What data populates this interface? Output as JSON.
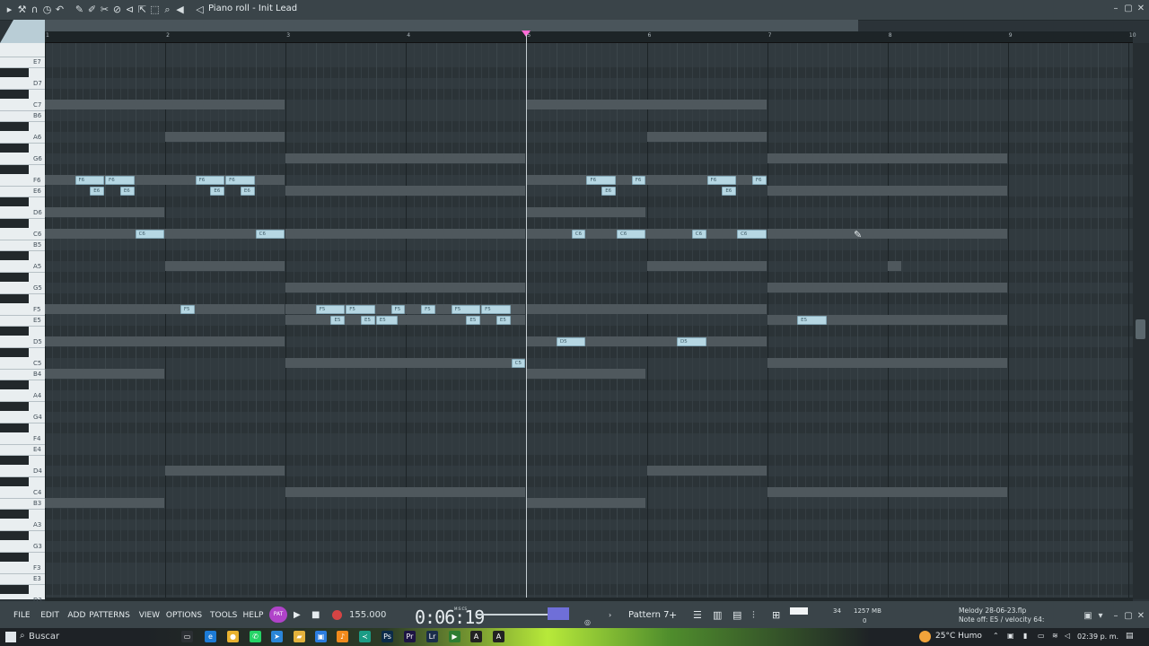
{
  "toolbar": {
    "title": "Piano roll - Init Lead",
    "icons": [
      "menu-arrow-icon",
      "wrench-icon",
      "magnet-icon",
      "stopwatch-icon",
      "undo-icon",
      "pencil-icon",
      "paint-icon",
      "delete-icon",
      "mute-icon",
      "slice-icon",
      "select-icon",
      "zoom-icon",
      "speaker-icon"
    ]
  },
  "ruler": {
    "bars": [
      "1",
      "2",
      "3",
      "4",
      "5",
      "6",
      "7",
      "8",
      "9",
      "10"
    ]
  },
  "keyboard": {
    "labels": [
      "E7",
      "D7",
      "C7",
      "B6",
      "A6",
      "G6",
      "F6",
      "E6",
      "D6",
      "C6",
      "B5",
      "A5",
      "G5",
      "F5",
      "E5",
      "D5",
      "C5",
      "B4",
      "A4",
      "G4",
      "F4",
      "E4",
      "D4",
      "C4",
      "B3",
      "A3",
      "G3",
      "F3",
      "E3",
      "D3"
    ]
  },
  "notes": [
    {
      "label": "F6",
      "pitch": "F6",
      "bar": 1.25,
      "len": 0.25
    },
    {
      "label": "F6",
      "pitch": "F6",
      "bar": 1.5,
      "len": 0.25
    },
    {
      "label": "E6",
      "pitch": "E6",
      "bar": 1.375,
      "len": 0.125
    },
    {
      "label": "E6",
      "pitch": "E6",
      "bar": 1.625,
      "len": 0.125
    },
    {
      "label": "C6",
      "pitch": "C6",
      "bar": 1.75,
      "len": 0.25
    },
    {
      "label": "F6",
      "pitch": "F6",
      "bar": 2.25,
      "len": 0.25
    },
    {
      "label": "F6",
      "pitch": "F6",
      "bar": 2.5,
      "len": 0.25
    },
    {
      "label": "E6",
      "pitch": "E6",
      "bar": 2.375,
      "len": 0.125
    },
    {
      "label": "E6",
      "pitch": "E6",
      "bar": 2.625,
      "len": 0.125
    },
    {
      "label": "C6",
      "pitch": "C6",
      "bar": 2.75,
      "len": 0.25
    },
    {
      "label": "F5",
      "pitch": "F5",
      "bar": 2.125,
      "len": 0.125
    },
    {
      "label": "F5",
      "pitch": "F5",
      "bar": 3.25,
      "len": 0.25
    },
    {
      "label": "F5",
      "pitch": "F5",
      "bar": 3.5,
      "len": 0.25
    },
    {
      "label": "E5",
      "pitch": "E5",
      "bar": 3.375,
      "len": 0.125
    },
    {
      "label": "E5",
      "pitch": "E5",
      "bar": 3.625,
      "len": 0.125
    },
    {
      "label": "E5",
      "pitch": "E5",
      "bar": 3.75,
      "len": 0.1875
    },
    {
      "label": "F5",
      "pitch": "F5",
      "bar": 3.875,
      "len": 0.125
    },
    {
      "label": "F5",
      "pitch": "F5",
      "bar": 4.125,
      "len": 0.125
    },
    {
      "label": "F5",
      "pitch": "F5",
      "bar": 4.375,
      "len": 0.25
    },
    {
      "label": "F5",
      "pitch": "F5",
      "bar": 4.625,
      "len": 0.25
    },
    {
      "label": "E5",
      "pitch": "E5",
      "bar": 4.5,
      "len": 0.125
    },
    {
      "label": "E5",
      "pitch": "E5",
      "bar": 4.75,
      "len": 0.125
    },
    {
      "label": "C5",
      "pitch": "C5",
      "bar": 4.875,
      "len": 0.125
    },
    {
      "label": "D5",
      "pitch": "D5",
      "bar": 5.25,
      "len": 0.25
    },
    {
      "label": "C6",
      "pitch": "C6",
      "bar": 5.375,
      "len": 0.125
    },
    {
      "label": "F6",
      "pitch": "F6",
      "bar": 5.5,
      "len": 0.25
    },
    {
      "label": "E6",
      "pitch": "E6",
      "bar": 5.625,
      "len": 0.125
    },
    {
      "label": "C6",
      "pitch": "C6",
      "bar": 5.75,
      "len": 0.25
    },
    {
      "label": "F6",
      "pitch": "F6",
      "bar": 5.875,
      "len": 0.125
    },
    {
      "label": "D5",
      "pitch": "D5",
      "bar": 6.25,
      "len": 0.25
    },
    {
      "label": "C6",
      "pitch": "C6",
      "bar": 6.375,
      "len": 0.125
    },
    {
      "label": "F6",
      "pitch": "F6",
      "bar": 6.5,
      "len": 0.25
    },
    {
      "label": "E6",
      "pitch": "E6",
      "bar": 6.625,
      "len": 0.125
    },
    {
      "label": "C6",
      "pitch": "C6",
      "bar": 6.75,
      "len": 0.25
    },
    {
      "label": "F6",
      "pitch": "F6",
      "bar": 6.875,
      "len": 0.125
    },
    {
      "label": "E5",
      "pitch": "E5",
      "bar": 7.25,
      "len": 0.25
    }
  ],
  "ghosts": [
    {
      "pitch": "C7",
      "bar": 1,
      "len": 2
    },
    {
      "pitch": "C6",
      "bar": 1,
      "len": 2
    },
    {
      "pitch": "F6",
      "bar": 1,
      "len": 2
    },
    {
      "pitch": "D6",
      "bar": 1,
      "len": 1
    },
    {
      "pitch": "F5",
      "bar": 1,
      "len": 2
    },
    {
      "pitch": "D5",
      "bar": 1,
      "len": 2
    },
    {
      "pitch": "B4",
      "bar": 1,
      "len": 1
    },
    {
      "pitch": "B3",
      "bar": 1,
      "len": 1
    },
    {
      "pitch": "A6",
      "bar": 2,
      "len": 1
    },
    {
      "pitch": "A5",
      "bar": 2,
      "len": 1
    },
    {
      "pitch": "D4",
      "bar": 2,
      "len": 1
    },
    {
      "pitch": "G6",
      "bar": 3,
      "len": 2
    },
    {
      "pitch": "E6",
      "bar": 3,
      "len": 2
    },
    {
      "pitch": "C6",
      "bar": 3,
      "len": 2
    },
    {
      "pitch": "G5",
      "bar": 3,
      "len": 2
    },
    {
      "pitch": "E5",
      "bar": 3,
      "len": 2
    },
    {
      "pitch": "C5",
      "bar": 3,
      "len": 2
    },
    {
      "pitch": "C4",
      "bar": 3,
      "len": 2
    },
    {
      "pitch": "F5",
      "bar": 3,
      "len": 2
    },
    {
      "pitch": "C7",
      "bar": 5,
      "len": 2
    },
    {
      "pitch": "C6",
      "bar": 5,
      "len": 2
    },
    {
      "pitch": "F6",
      "bar": 5,
      "len": 2
    },
    {
      "pitch": "D6",
      "bar": 5,
      "len": 1
    },
    {
      "pitch": "F5",
      "bar": 5,
      "len": 2
    },
    {
      "pitch": "D5",
      "bar": 5,
      "len": 2
    },
    {
      "pitch": "B4",
      "bar": 5,
      "len": 1
    },
    {
      "pitch": "B3",
      "bar": 5,
      "len": 1
    },
    {
      "pitch": "A6",
      "bar": 6,
      "len": 1
    },
    {
      "pitch": "A5",
      "bar": 6,
      "len": 1
    },
    {
      "pitch": "D4",
      "bar": 6,
      "len": 1
    },
    {
      "pitch": "G6",
      "bar": 7,
      "len": 2
    },
    {
      "pitch": "E6",
      "bar": 7,
      "len": 2
    },
    {
      "pitch": "C6",
      "bar": 7,
      "len": 2
    },
    {
      "pitch": "G5",
      "bar": 7,
      "len": 2
    },
    {
      "pitch": "E5",
      "bar": 7,
      "len": 2
    },
    {
      "pitch": "C5",
      "bar": 7,
      "len": 2
    },
    {
      "pitch": "C4",
      "bar": 7,
      "len": 2
    },
    {
      "pitch": "A5",
      "bar": 8,
      "len": 0.125
    }
  ],
  "transport": {
    "menus": [
      "FILE",
      "EDIT",
      "ADD",
      "PATTERNS",
      "VIEW",
      "OPTIONS",
      "TOOLS",
      "HELP"
    ],
    "pat_label": "PAT",
    "tempo": "155.000",
    "time": "0:06:19",
    "time_unit": "M:S:CS",
    "pattern": "Pattern 7",
    "cpu": "34",
    "memory": "1257 MB",
    "memory_sub": "0",
    "project_file": "Melody 28-06-23.flp",
    "hint": "Note off: E5 / velocity 64:"
  },
  "taskbar": {
    "search_placeholder": "Buscar",
    "weather": "25°C  Humo",
    "time": "02:39 p. m."
  },
  "colors": {
    "note": "#b6d7e3",
    "grid": "#313a3f",
    "playhead_marker": "#ff6bd6",
    "pat": "#b043c9"
  }
}
